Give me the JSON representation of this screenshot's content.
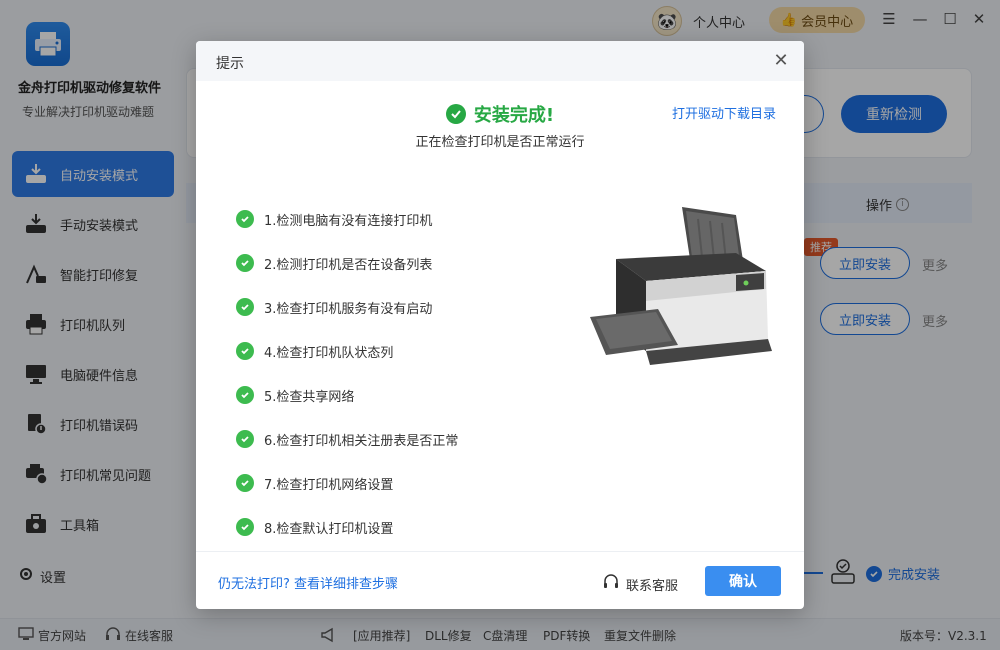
{
  "app": {
    "name": "金舟打印机驱动修复软件",
    "subtitle": "专业解决打印机驱动难题"
  },
  "topbar": {
    "user_center": "个人中心",
    "vip_center": "会员中心"
  },
  "sidebar": {
    "items": [
      {
        "label": "自动安装模式",
        "icon": "auto-install-icon"
      },
      {
        "label": "手动安装模式",
        "icon": "manual-install-icon"
      },
      {
        "label": "智能打印修复",
        "icon": "smart-repair-icon"
      },
      {
        "label": "打印机队列",
        "icon": "printer-queue-icon"
      },
      {
        "label": "电脑硬件信息",
        "icon": "hardware-info-icon"
      },
      {
        "label": "打印机错误码",
        "icon": "error-code-icon"
      },
      {
        "label": "打印机常见问题",
        "icon": "faq-icon"
      },
      {
        "label": "工具箱",
        "icon": "toolbox-icon"
      }
    ],
    "settings": "设置"
  },
  "main": {
    "recheck": "重新检测",
    "op_header": "操作",
    "recommend_badge": "推荐",
    "install_now": "立即安装",
    "more": "更多",
    "done_install": "完成安装"
  },
  "footer": {
    "official_site": "官方网站",
    "online_service": "在线客服",
    "app_recommend": "[应用推荐]",
    "dll_repair": "DLL修复",
    "c_clean": "C盘清理",
    "pdf_convert": "PDF转换",
    "dup_delete": "重复文件删除",
    "version": "版本号：V2.3.1"
  },
  "dialog": {
    "title": "提示",
    "success": "安装完成!",
    "open_driver_dir": "打开驱动下载目录",
    "checking": "正在检查打印机是否正常运行",
    "steps": [
      "1.检测电脑有没有连接打印机",
      "2.检测打印机是否在设备列表",
      "3.检查打印机服务有没有启动",
      "4.检查打印机队状态列",
      "5.检查共享网络",
      "6.检查打印机相关注册表是否正常",
      "7.检查打印机网络设置",
      "8.检查默认打印机设置"
    ],
    "cant_print": "仍无法打印?  查看详细排查步骤",
    "contact_service": "联系客服",
    "confirm": "确认"
  },
  "colors": {
    "accent": "#1e6fe0",
    "success": "#27a844",
    "recommend": "#e55a2b"
  }
}
